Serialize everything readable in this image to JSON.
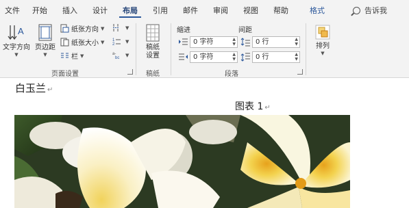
{
  "tabs": [
    "文件",
    "开始",
    "插入",
    "设计",
    "布局",
    "引用",
    "邮件",
    "审阅",
    "视图",
    "帮助",
    "格式"
  ],
  "active_tab": "布局",
  "tell_me": "告诉我",
  "page_setup": {
    "text_direction": "文字方向",
    "margins": "页边距",
    "orientation": "纸张方向",
    "size": "纸张大小",
    "columns": "栏",
    "group_label": "页面设置"
  },
  "manuscript": {
    "line1": "稿纸",
    "line2": "设置",
    "group_label": "稿纸"
  },
  "paragraph": {
    "indent_label": "缩进",
    "spacing_label": "间距",
    "indent_left": "0 字符",
    "indent_right": "0 字符",
    "spacing_before": "0 行",
    "spacing_after": "0 行",
    "group_label": "段落"
  },
  "arrange": {
    "label": "排列"
  },
  "document": {
    "heading": "白玉兰",
    "caption": "图表 1"
  },
  "colors": {
    "accent": "#2b579a",
    "ribbon_bg": "#f3f3f3"
  }
}
